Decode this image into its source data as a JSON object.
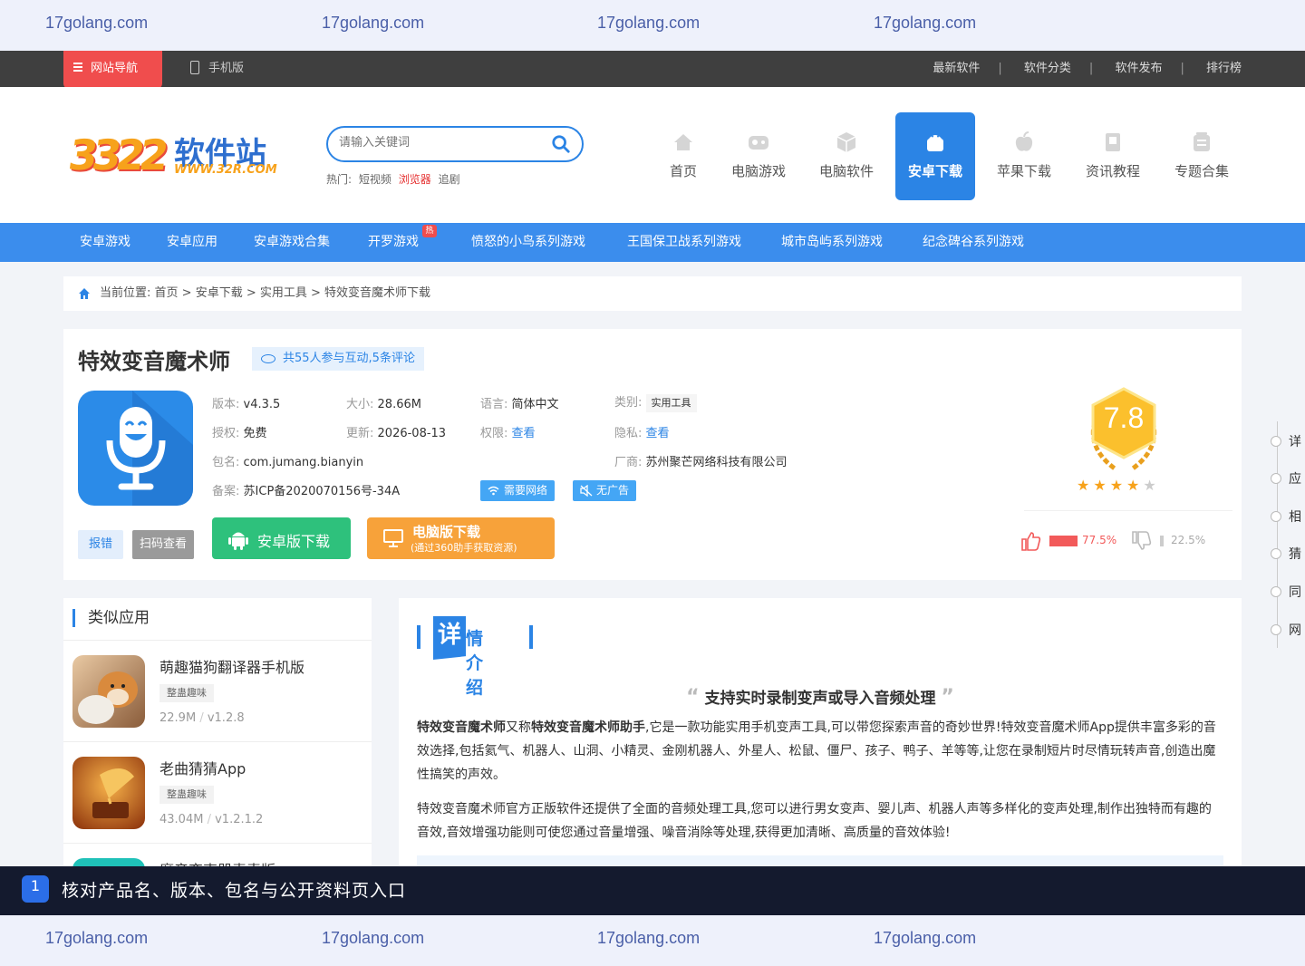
{
  "watermark": {
    "top": [
      "17golang.com",
      "17golang.com",
      "17golang.com",
      "17golang.com"
    ],
    "bottom": [
      "17golang.com",
      "17golang.com",
      "17golang.com",
      "17golang.com"
    ]
  },
  "topbar": {
    "nav_label": "网站导航",
    "mobile_label": "手机版",
    "links": [
      "最新软件",
      "软件分类",
      "软件发布",
      "排行榜"
    ]
  },
  "header": {
    "search_placeholder": "请输入关键词",
    "hot_label": "热门:",
    "hot_items": [
      "短视频",
      "浏览器",
      "追剧"
    ],
    "logo_num": "3322",
    "logo_cn": "软件站",
    "logo_en": "WWW.32R.COM",
    "nav": [
      "首页",
      "电脑游戏",
      "电脑软件",
      "安卓下载",
      "苹果下载",
      "资讯教程",
      "专题合集"
    ]
  },
  "subnav": {
    "items": [
      "安卓游戏",
      "安卓应用",
      "安卓游戏合集",
      "开罗游戏",
      "愤怒的小鸟系列游戏",
      "王国保卫战系列游戏",
      "城市岛屿系列游戏",
      "纪念碑谷系列游戏"
    ],
    "hot_badge": "热"
  },
  "breadcrumb": {
    "label": "当前位置:",
    "path": "首页 > 安卓下载 > 实用工具 > 特效变音魔术师下载"
  },
  "app": {
    "title": "特效变音魔术师",
    "comments": "共55人参与互动,5条评论",
    "version_label": "版本:",
    "version": "v4.3.5",
    "size_label": "大小:",
    "size": "28.66M",
    "lang_label": "语言:",
    "lang": "简体中文",
    "category_label": "类别:",
    "category": "实用工具",
    "license_label": "授权:",
    "license": "免费",
    "update_label": "更新:",
    "update": "2026-08-13",
    "perm_label": "权限:",
    "perm": "查看",
    "privacy_label": "隐私:",
    "privacy": "查看",
    "package_label": "包名:",
    "package": "com.jumang.bianyin",
    "vendor_label": "厂商:",
    "vendor": "苏州聚芒网络科技有限公司",
    "icp_label": "备案:",
    "icp": "苏ICP备2020070156号-34A",
    "chip_network": "需要网络",
    "chip_noads": "无广告",
    "report": "报错",
    "scan": "扫码查看",
    "android_dl": "安卓版下载",
    "pc_dl": "电脑版下载",
    "pc_dl_sub": "(通过360助手获取资源)",
    "score": "7.8",
    "rating_stars": 4,
    "like_pct": "77.5%",
    "dislike_pct": "22.5%",
    "like_value": 77.5,
    "dislike_value": 22.5
  },
  "similar": {
    "title": "类似应用",
    "items": [
      {
        "name": "萌趣猫狗翻译器手机版",
        "category": "整蛊趣味",
        "size": "22.9M",
        "version": "v1.2.8"
      },
      {
        "name": "老曲猜猜App",
        "category": "整蛊趣味",
        "size": "43.04M",
        "version": "v1.2.1.2"
      },
      {
        "name": "魔音变声器毒毒版",
        "category": "",
        "size": "",
        "version": ""
      }
    ]
  },
  "detail": {
    "heading_big": "详",
    "heading_rest": "情介绍",
    "quote": "支持实时录制变声或导入音频处理",
    "p1_b1": "特效变音魔术师",
    "p1_t1": "又称",
    "p1_b2": "特效变音魔术师助手",
    "p1_t2": ",它是一款功能实用手机变声工具,可以带您探索声音的奇妙世界!特效变音魔术师App提供丰富多彩的音效选择,包括氦气、机器人、山洞、小精灵、金刚机器人、外星人、松鼠、僵尸、孩子、鸭子、羊等等,让您在录制短片时尽情玩转声音,创造出魔性搞笑的声效。",
    "p2": "特效变音魔术师官方正版软件还提供了全面的音频处理工具,您可以进行男女变声、婴儿声、机器人声等多样化的变声处理,制作出独特而有趣的音效,音效增强功能则可使您通过音量增强、噪音消除等处理,获得更加清晰、高质量的音效体验!"
  },
  "sidenav": [
    "详",
    "应",
    "相",
    "猜",
    "同",
    "网"
  ],
  "bottombar": {
    "badge": "1",
    "text": "核对产品名、版本、包名与公开资料页入口"
  }
}
